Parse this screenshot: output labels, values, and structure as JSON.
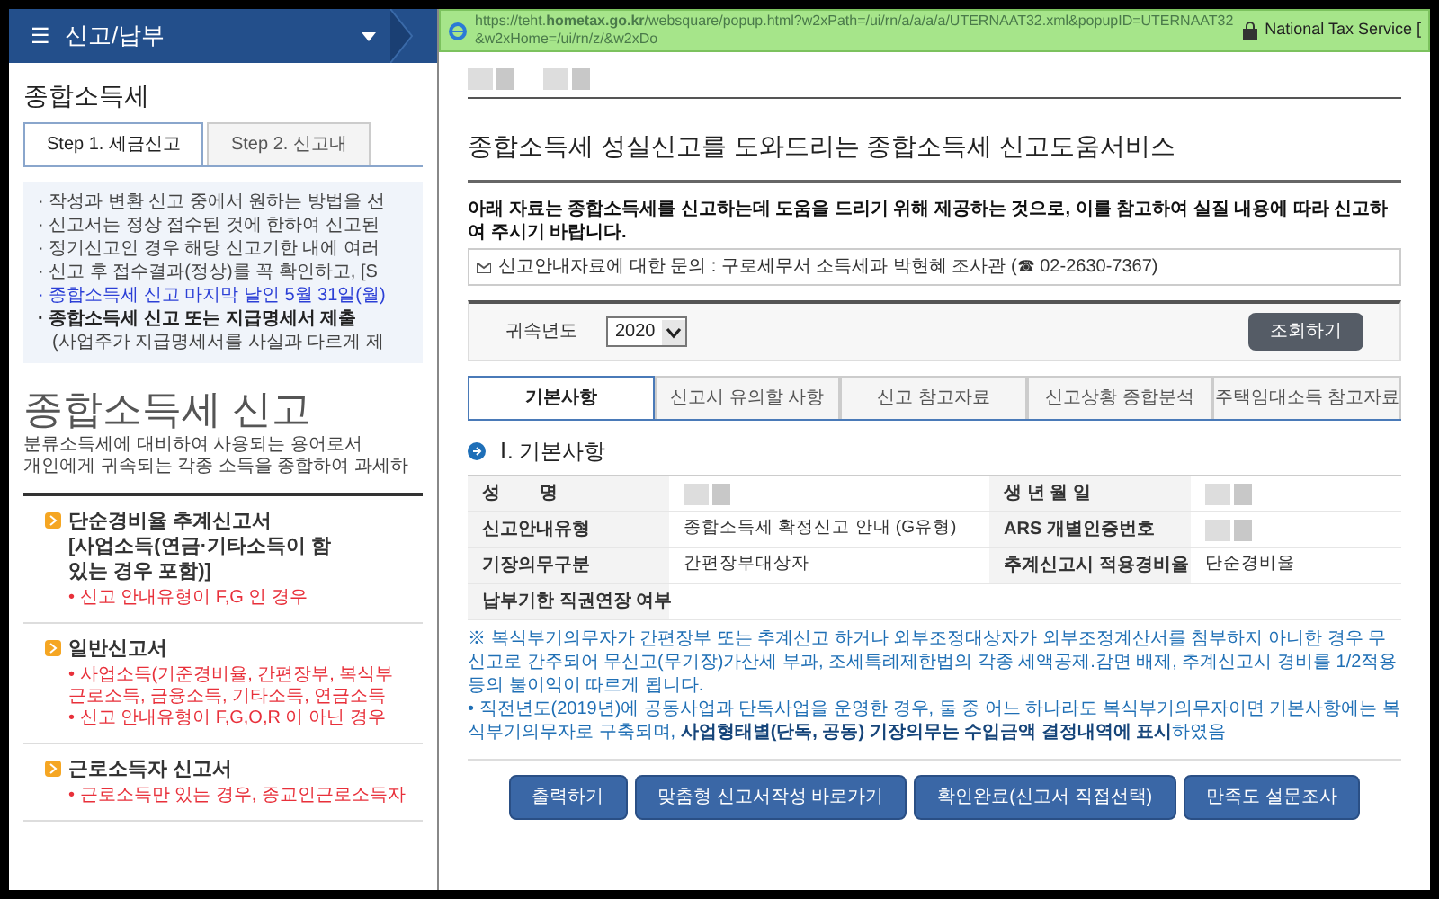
{
  "left_page": {
    "menu": {
      "icon": "☰",
      "label": "신고/납부"
    },
    "title": "종합소득세",
    "tabs": [
      {
        "label": "Step 1. 세금신고",
        "selected": true
      },
      {
        "label": "Step 2. 신고내",
        "selected": false
      }
    ],
    "notices": [
      {
        "kind": "plain",
        "text": "· 작성과 변환 신고 중에서 원하는 방법을 선"
      },
      {
        "kind": "plain",
        "text": "· 신고서는 정상 접수된 것에 한하여 신고된"
      },
      {
        "kind": "plain",
        "text": "· 정기신고인 경우 해당 신고기한 내에 여러"
      },
      {
        "kind": "plain",
        "text": "· 신고 후 접수결과(정상)를 꼭 확인하고, [S"
      },
      {
        "kind": "link",
        "text": "· 종합소득세 신고 마지막 날인 5월 31일(월)"
      },
      {
        "kind": "bold",
        "text": "· 종합소득세 신고 또는 지급명세서 제출"
      },
      {
        "kind": "sub",
        "text": "(사업주가 지급명세서를 사실과 다르게 제"
      }
    ],
    "heading": "종합소득세 신고",
    "description": [
      "분류소득세에 대비하여 사용되는 용어로서",
      "개인에게 귀속되는 각종 소득을 종합하여 과세하"
    ],
    "forms": [
      {
        "title_lines": [
          "단순경비율 추계신고서",
          "[사업소득(연금·기타소득이 함",
          "있는 경우 포함)]"
        ],
        "conditions": [
          "• 신고 안내유형이 F,G 인 경우"
        ]
      },
      {
        "title_lines": [
          "일반신고서"
        ],
        "conditions": [
          "• 사업소득(기준경비율, 간편장부, 복식부",
          "근로소득, 금융소득, 기타소득, 연금소득",
          "• 신고 안내유형이 F,G,O,R 이 아닌 경우"
        ]
      },
      {
        "title_lines": [
          "근로소득자 신고서"
        ],
        "conditions": [
          "• 근로소득만 있는 경우, 종교인근로소득자"
        ]
      }
    ]
  },
  "popup": {
    "url": "https://teht.**hometax.go.kr**/websquare/popup.html?w2xPath=/ui/rn/a/a/a/a/UTERNAAT32.xml&popupID=UTERNAAT32&w2xHome=/ui/rn/z/&w2xDo",
    "site": "National Tax Service [",
    "title": "종합소득세 성실신고를 도와드리는 종합소득세 신고도움서비스",
    "intro": "아래 자료는 종합소득세를 신고하는데 도움을 드리기 위해 제공하는 것으로, 이를 참고하여 실질 내용에 따라 신고하여 주시기 바랍니다.",
    "inquiry": "신고안내자료에 대한 문의 : 구로세무서 소득세과 박현혜 조사관 (☎ 02-2630-7367)",
    "filter": {
      "label": "귀속년도",
      "year": "2020",
      "button": "조회하기"
    },
    "tabs": [
      {
        "label": "기본사항",
        "selected": true
      },
      {
        "label": "신고시 유의할 사항",
        "selected": false
      },
      {
        "label": "신고 참고자료",
        "selected": false
      },
      {
        "label": "신고상황 종합분석",
        "selected": false
      },
      {
        "label": "주택임대소득 참고자료",
        "selected": false
      }
    ],
    "section": {
      "number": "Ⅰ.",
      "title": "기본사항"
    },
    "basic_info": [
      [
        {
          "label": "성        명",
          "redacted": true
        },
        {
          "label": "생 년 월 일",
          "redacted": true
        }
      ],
      [
        {
          "label": "신고안내유형",
          "value": "종합소득세 확정신고 안내 (G유형)"
        },
        {
          "label": "ARS 개별인증번호",
          "redacted": true
        }
      ],
      [
        {
          "label": "기장의무구분",
          "value": "간편장부대상자"
        },
        {
          "label": "추계신고시 적용경비율",
          "value": "단순경비율"
        }
      ],
      [
        {
          "label": "납부기한 직권연장 여부"
        }
      ]
    ],
    "notes": [
      "※ 복식부기의무자가 간편장부 또는 추계신고 하거나 외부조정대상자가 외부조정계산서를 첨부하지 아니한 경우 무신고로 간주되어 무신고(무기장)가산세 부과, 조세특례제한법의 각종 세액공제.감면 배제, 추계신고시 경비를 1/2적용 등의 불이익이 따르게 됩니다.",
      "• 직전년도(2019년)에 공동사업과 단독사업을 운영한 경우, 둘 중 어느 하나라도 복식부기의무자이면 기본사항에는 복식부기의무자로 구축되며, **사업형태별(단독, 공동) 기장의무는 수입금액 결정내역에 표시**하였음"
    ],
    "buttons": [
      "출력하기",
      "맞춤형 신고서작성 바로가기",
      "확인완료(신고서 직접선택)",
      "만족도 설문조사"
    ]
  }
}
